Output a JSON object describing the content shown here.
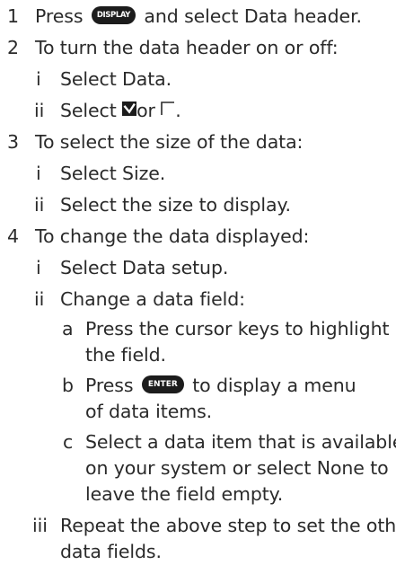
{
  "steps": [
    {
      "number": "1",
      "parts": {
        "before": "Press",
        "button": "DISPLAY",
        "after": "and select Data header."
      }
    },
    {
      "number": "2",
      "text": "To turn the data header on or off:",
      "substeps": [
        {
          "number": "i",
          "text": "Select Data."
        },
        {
          "number": "ii",
          "before": "Select",
          "middle": "or",
          "after": "."
        }
      ]
    },
    {
      "number": "3",
      "text": "To select the size of the data:",
      "substeps": [
        {
          "number": "i",
          "text": "Select Size."
        },
        {
          "number": "ii",
          "text": "Select the size to display."
        }
      ]
    },
    {
      "number": "4",
      "text": "To change the data displayed:",
      "substeps": [
        {
          "number": "i",
          "text": "Select Data setup."
        },
        {
          "number": "ii",
          "text": "Change a data field:",
          "items": [
            {
              "letter": "a",
              "line1": "Press the cursor keys to highlight",
              "line2": "the field."
            },
            {
              "letter": "b",
              "before": "Press",
              "button": "ENTER",
              "after": "to display a menu",
              "line2": "of data items."
            },
            {
              "letter": "c",
              "line1": "Select a data item that is available",
              "line2": "on your system or select None to",
              "line3": "leave the field empty."
            }
          ]
        },
        {
          "number": "iii",
          "line1": "Repeat the above step to set the other",
          "line2": "data fields."
        }
      ]
    }
  ],
  "icons": {
    "checked_box": "checkbox-checked-icon",
    "unchecked_box": "checkbox-unchecked-icon"
  }
}
